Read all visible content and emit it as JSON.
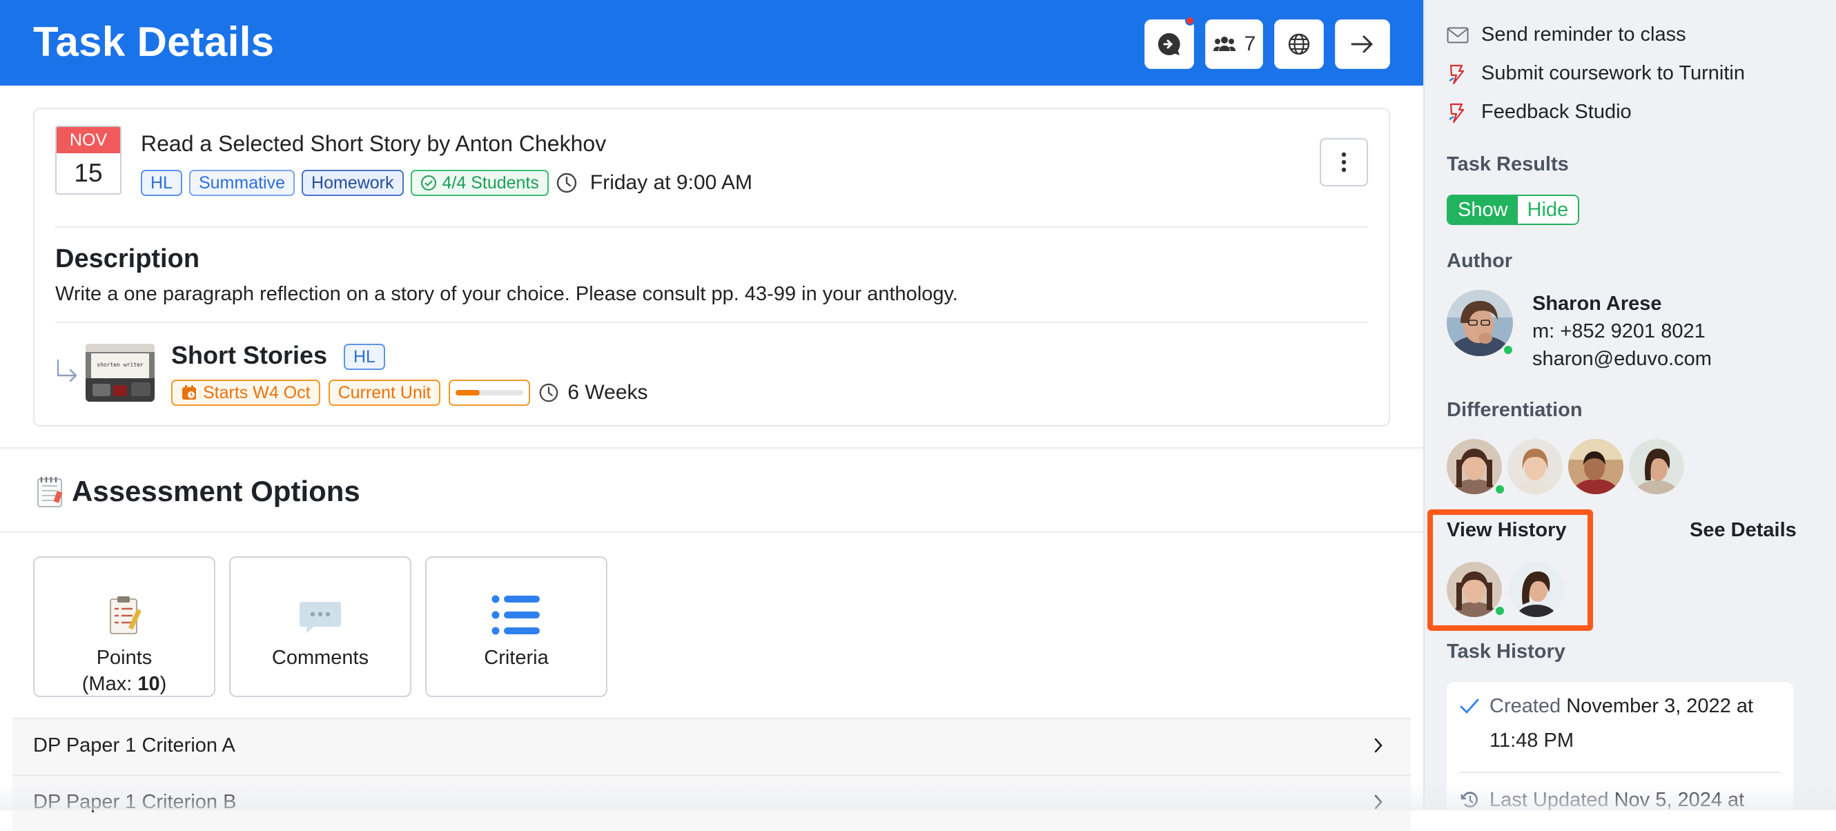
{
  "header": {
    "title": "Task Details",
    "participants_count": "7",
    "bg_color": "#1a73e8"
  },
  "task": {
    "date_month": "NOV",
    "date_day": "15",
    "title": "Read a Selected Short Story by Anton Chekhov",
    "tags": [
      "HL",
      "Summative",
      "Homework"
    ],
    "students_tag": "4/4 Students",
    "due": "Friday at 9:00 AM",
    "description_heading": "Description",
    "description": "Write a one paragraph reflection on a story of your choice. Please consult pp. 43-99 in your anthology.",
    "unit": {
      "title": "Short Stories",
      "level": "HL",
      "starts": "Starts W4 Oct",
      "status": "Current Unit",
      "progress": 0.35,
      "duration": "6 Weeks"
    }
  },
  "assessment": {
    "title": "Assessment Options",
    "options": {
      "points": "Points",
      "points_max_prefix": "(Max: ",
      "points_max": "10",
      "points_max_suffix": ")",
      "comments": "Comments",
      "criteria": "Criteria"
    },
    "criteria_rows": [
      "DP Paper 1 Criterion A",
      "DP Paper 1 Criterion B"
    ]
  },
  "panel": {
    "links": [
      "Send reminder to class",
      "Submit coursework to Turnitin",
      "Feedback Studio"
    ],
    "task_results_heading": "Task Results",
    "toggle_show": "Show",
    "toggle_hide": "Hide",
    "author_heading": "Author",
    "author": {
      "name": "Sharon Arese",
      "phone": "m: +852 9201 8021",
      "email": "sharon@eduvo.com"
    },
    "differentiation_heading": "Differentiation",
    "view_history": "View History",
    "see_details": "See Details",
    "task_history_heading": "Task History",
    "history": {
      "created_label": "Created",
      "created_value": "November 3, 2022 at",
      "created_time": "11:48 PM",
      "updated_label": "Last Updated",
      "updated_value": "Nov 5, 2024 at"
    },
    "highlight_color": "#fb5a1a"
  }
}
